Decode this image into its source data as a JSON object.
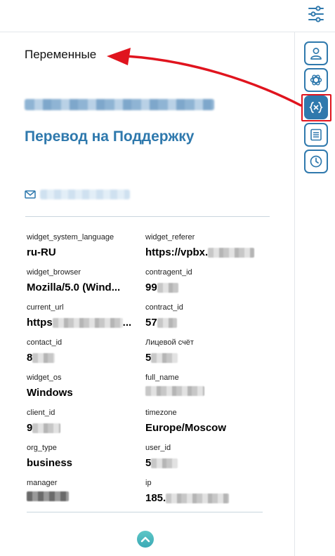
{
  "panel": {
    "section_title": "Переменные",
    "headline": "Перевод на Поддержку",
    "variables": [
      {
        "key": "widget_system_language",
        "value": "ru-RU"
      },
      {
        "key": "widget_referer",
        "value": "https://vpbx."
      },
      {
        "key": "widget_browser",
        "value": "Mozilla/5.0 (Wind..."
      },
      {
        "key": "contragent_id",
        "value": "99"
      },
      {
        "key": "current_url",
        "value": "https"
      },
      {
        "key": "contract_id",
        "value": "57"
      },
      {
        "key": "contact_id",
        "value": "8"
      },
      {
        "key": "Лицевой счёт",
        "value": "5"
      },
      {
        "key": "widget_os",
        "value": "Windows"
      },
      {
        "key": "full_name",
        "value": ""
      },
      {
        "key": "client_id",
        "value": "9"
      },
      {
        "key": "timezone",
        "value": "Europe/Moscow"
      },
      {
        "key": "org_type",
        "value": "business"
      },
      {
        "key": "user_id",
        "value": "5"
      },
      {
        "key": "manager",
        "value": ""
      },
      {
        "key": "ip",
        "value": "185."
      }
    ],
    "current_url_suffix": "..."
  },
  "sidebar": {
    "buttons": [
      {
        "icon": "user-icon",
        "active": false
      },
      {
        "icon": "openai-icon",
        "active": false
      },
      {
        "icon": "variables-icon",
        "active": true
      },
      {
        "icon": "document-icon",
        "active": false
      },
      {
        "icon": "clock-icon",
        "active": false
      }
    ]
  },
  "colors": {
    "accent": "#2f79ad",
    "highlight": "#e0141e",
    "collapse": "#3ba9b5"
  }
}
